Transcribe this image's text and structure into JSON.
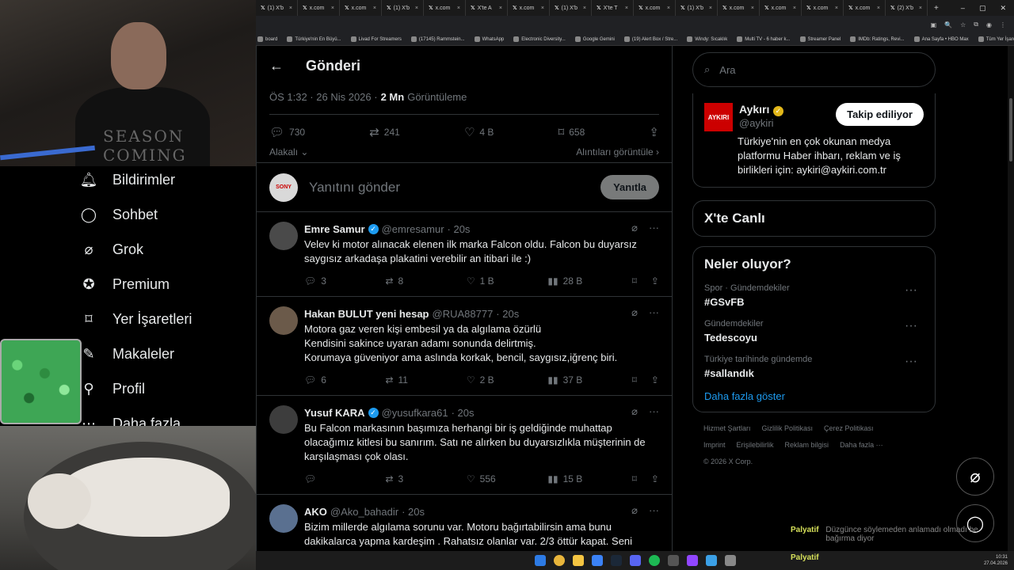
{
  "browser": {
    "tabs": [
      "(1) X'b",
      "x.com",
      "x.com",
      "(1) X'b",
      "x.com",
      "X'te A",
      "x.com",
      "(1) X'b",
      "X'te T",
      "x.com",
      "(1) X'b",
      "x.com",
      "x.com",
      "x.com",
      "x.com",
      "(2) X'b"
    ],
    "bookmarks": [
      "board",
      "Türkiye'nin En Büyü...",
      "Livad For Streamers",
      "(17145) Rammstein...",
      "WhatsApp",
      "Electronic Diversity...",
      "Google Gemini",
      "(19) Alert Box / Stre...",
      "Windy: Sıcaklık",
      "Multi TV - 6 haber k...",
      "Streamer Panel",
      "IMDb: Ratings, Revi...",
      "Ana Sayfa • HBO Max",
      "Tüm Yer İşaretleri"
    ]
  },
  "webcam": {
    "overlay_text": "SEASON COMING"
  },
  "nav": [
    {
      "label": "Bildirimler",
      "icon": "bell-icon"
    },
    {
      "label": "Sohbet",
      "icon": "chat-icon"
    },
    {
      "label": "Grok",
      "icon": "grok-icon"
    },
    {
      "label": "Premium",
      "icon": "premium-icon"
    },
    {
      "label": "Yer İşaretleri",
      "icon": "bookmark-icon"
    },
    {
      "label": "Makaleler",
      "icon": "articles-icon"
    },
    {
      "label": "Profil",
      "icon": "profile-icon"
    },
    {
      "label": "Daha fazla",
      "icon": "more-icon"
    }
  ],
  "post": {
    "header_title": "Gönderi",
    "time": "ÖS 1:32 · 26 Nis 2026 ·",
    "views_count": "2 Mn",
    "views_label": "Görüntüleme",
    "replies": "730",
    "reposts": "241",
    "likes": "4 B",
    "bookmarks": "658",
    "relevant_label": "Alakalı",
    "quotes_label": "Alıntıları görüntüle",
    "reply_placeholder": "Yanıtını gönder",
    "reply_button": "Yanıtla",
    "reply_avatar_text": "SONY"
  },
  "tweets": [
    {
      "name": "Emre Samur",
      "verified": true,
      "handle": "@emresamur",
      "time": "· 20s",
      "text": "Velev ki motor alınacak elenen ilk marka Falcon oldu. Falcon bu duyarsız saygısız arkadaşa plakatini verebilir an itibari ile :)",
      "replies": "3",
      "reposts": "8",
      "likes": "1 B",
      "views": "28 B"
    },
    {
      "name": "Hakan BULUT yeni hesap",
      "verified": false,
      "handle": "@RUA88777",
      "time": "· 20s",
      "text": "Motora gaz veren kişi  embesil ya da algılama özürlü\nKendisini sakince uyaran adamı sonunda delirtmiş.\nKorumaya güveniyor ama aslında korkak, bencil, saygısız,iğrenç biri.",
      "replies": "6",
      "reposts": "11",
      "likes": "2 B",
      "views": "37 B"
    },
    {
      "name": "Yusuf KARA",
      "verified": true,
      "handle": "@yusufkara61",
      "time": "· 20s",
      "text": "Bu Falcon markasının başımıza herhangi bir iş geldiğinde muhattap olacağımız kitlesi bu sanırım. Satı ne alırken bu duyarsızlıkla müşterinin de karşılaşması çok olası.",
      "replies": "",
      "reposts": "3",
      "likes": "556",
      "views": "15 B"
    },
    {
      "name": "AKO",
      "verified": false,
      "handle": "@Ako_bahadir",
      "time": "· 20s",
      "text": "Bizim millerde algılama sorunu var. Motoru bağırtabilirsin ama bunu dakikalarca yapma kardeşim . Rahatsız olanlar var. 2/3 öttür kapat. Seni uyaran adam ilkte çok nazik bir dille uyarıyo. Tamamen saygısızlık",
      "replies": "",
      "reposts": "",
      "likes": "",
      "views": ""
    }
  ],
  "right": {
    "search_placeholder": "Ara",
    "account": {
      "logo_text": "AYKIRI",
      "name": "Aykırı",
      "handle": "@aykiri",
      "follow_label": "Takip ediliyor",
      "bio": "Türkiye'nin en çok okunan medya platformu Haber ihbarı, reklam ve iş birlikleri için: aykiri@aykiri.com.tr"
    },
    "live_title": "X'te Canlı",
    "trends_title": "Neler oluyor?",
    "trends": [
      {
        "category": "Spor · Gündemdekiler",
        "tag": "#GSvFB"
      },
      {
        "category": "Gündemdekiler",
        "tag": "Tedescoyu"
      },
      {
        "category": "Türkiye tarihinde gündemde",
        "tag": "#sallandık"
      }
    ],
    "show_more": "Daha fazla göster",
    "footer": [
      "Hizmet Şartları",
      "Gizlilik Politikası",
      "Çerez Politikası",
      "Imprint",
      "Erişilebilirlik",
      "Reklam bilgisi",
      "Daha fazla ···",
      "© 2026 X Corp."
    ]
  },
  "stream_chat": {
    "user": "Palyatif",
    "message": "Düzgünce söylemeden anlamadı olmadı be bağırma diyor"
  },
  "taskbar": {
    "user_label": "Palyatif",
    "time": "10:31",
    "date": "27.04.2026"
  },
  "colors": {
    "accent": "#1d9bf0",
    "background": "#000000",
    "muted": "#71767b",
    "border": "#2f3336"
  }
}
